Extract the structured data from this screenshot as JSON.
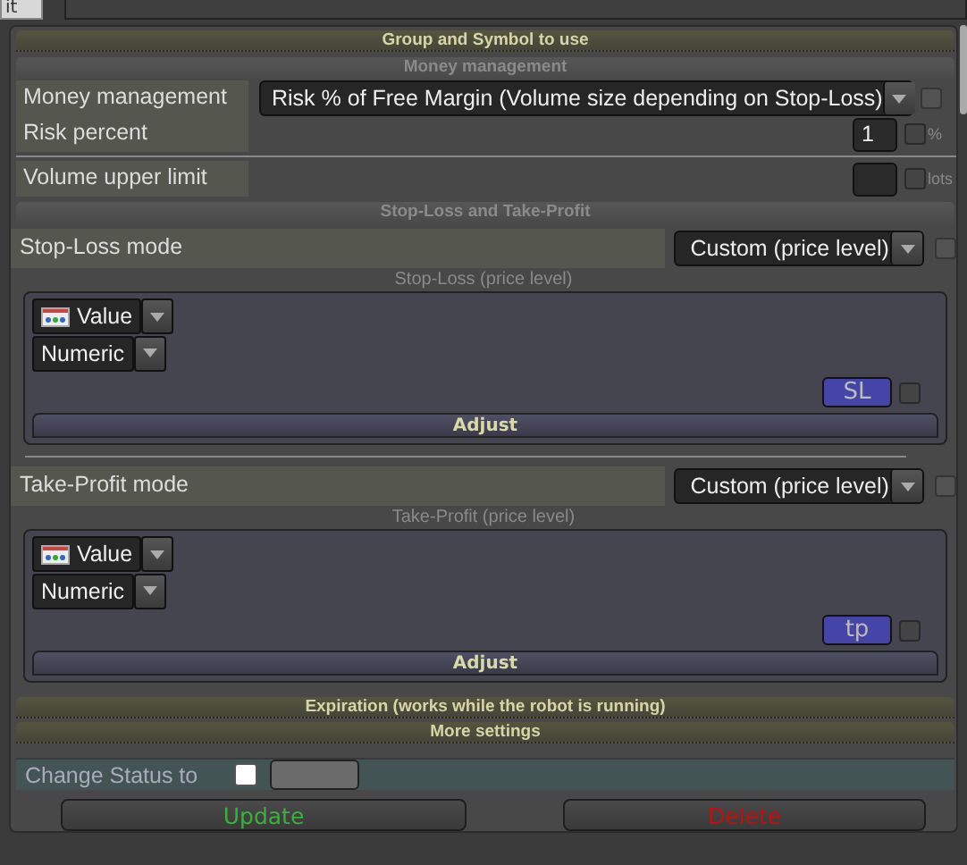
{
  "top_button": {
    "label": "it"
  },
  "header": "Group and Symbol to use",
  "money": {
    "title": "Money management",
    "rows": [
      {
        "kind": "select",
        "label": "Money management",
        "value": "Risk % of Free Margin (Volume size depending on Stop-Loss)",
        "checked": false,
        "divider_above": false
      },
      {
        "kind": "number",
        "label": "Risk percent",
        "value": "1",
        "unit": "%",
        "checked": false,
        "divider_above": false
      },
      {
        "kind": "number",
        "label": "Volume upper limit",
        "unit": "lots",
        "checked": false,
        "divider_above": true
      }
    ]
  },
  "sltp": {
    "title": "Stop-Loss and Take-Profit",
    "blocks": [
      {
        "mode_label": "Stop-Loss mode",
        "mode": "Custom (price level)",
        "checked": false,
        "caption": "Stop-Loss (price level)",
        "source": "Value",
        "format": "Numeric",
        "line_button": "SL",
        "line_checked": false,
        "adjust": "Adjust"
      },
      {
        "mode_label": "Take-Profit mode",
        "mode": "Custom (price level)",
        "checked": false,
        "caption": "Take-Profit (price level)",
        "source": "Value",
        "format": "Numeric",
        "line_button": "tp",
        "line_checked": false,
        "adjust": "Adjust"
      }
    ]
  },
  "collapsed": [
    "Expiration (works while the robot is running)",
    "More settings"
  ],
  "status": {
    "label": "Change Status to",
    "checked": false
  },
  "buttons": [
    {
      "label": "Update",
      "kind": "update"
    },
    {
      "label": "Delete",
      "kind": "delete"
    }
  ]
}
